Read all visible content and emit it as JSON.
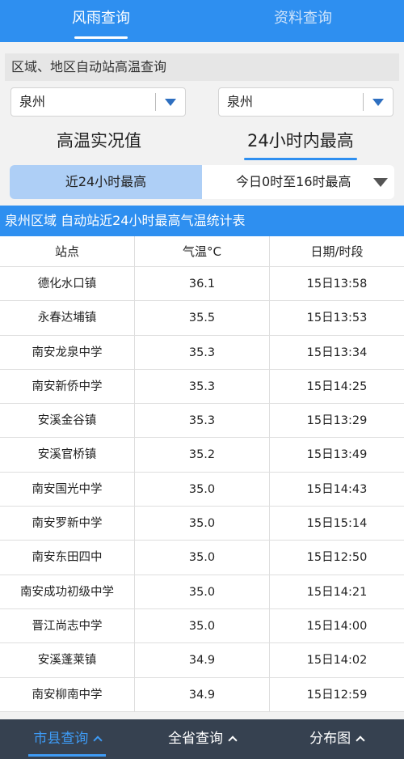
{
  "top_tabs": [
    {
      "label": "风雨查询",
      "active": true
    },
    {
      "label": "资料查询",
      "active": false
    }
  ],
  "section_label": "区域、地区自动站高温查询",
  "selects": {
    "region": "泉州",
    "area": "泉州"
  },
  "sub_tabs": [
    {
      "label": "高温实况值",
      "active": false
    },
    {
      "label": "24小时内最高",
      "active": true
    }
  ],
  "segment": {
    "left": "近24小时最高",
    "right": "今日0时至16时最高"
  },
  "table_title": "泉州区域 自动站近24小时最高气温统计表",
  "table": {
    "headers": [
      "站点",
      "气温°C",
      "日期/时段"
    ],
    "rows": [
      [
        "德化水口镇",
        "36.1",
        "15日13:58"
      ],
      [
        "永春达埔镇",
        "35.5",
        "15日13:53"
      ],
      [
        "南安龙泉中学",
        "35.3",
        "15日13:34"
      ],
      [
        "南安新侨中学",
        "35.3",
        "15日14:25"
      ],
      [
        "安溪金谷镇",
        "35.3",
        "15日13:29"
      ],
      [
        "安溪官桥镇",
        "35.2",
        "15日13:49"
      ],
      [
        "南安国光中学",
        "35.0",
        "15日14:43"
      ],
      [
        "南安罗新中学",
        "35.0",
        "15日15:14"
      ],
      [
        "南安东田四中",
        "35.0",
        "15日12:50"
      ],
      [
        "南安成功初级中学",
        "35.0",
        "15日14:21"
      ],
      [
        "晋江尚志中学",
        "35.0",
        "15日14:00"
      ],
      [
        "安溪蓬莱镇",
        "34.9",
        "15日14:02"
      ],
      [
        "南安柳南中学",
        "34.9",
        "15日12:59"
      ]
    ]
  },
  "bottom_tabs": [
    {
      "label": "市县查询",
      "active": true
    },
    {
      "label": "全省查询",
      "active": false
    },
    {
      "label": "分布图",
      "active": false
    }
  ]
}
